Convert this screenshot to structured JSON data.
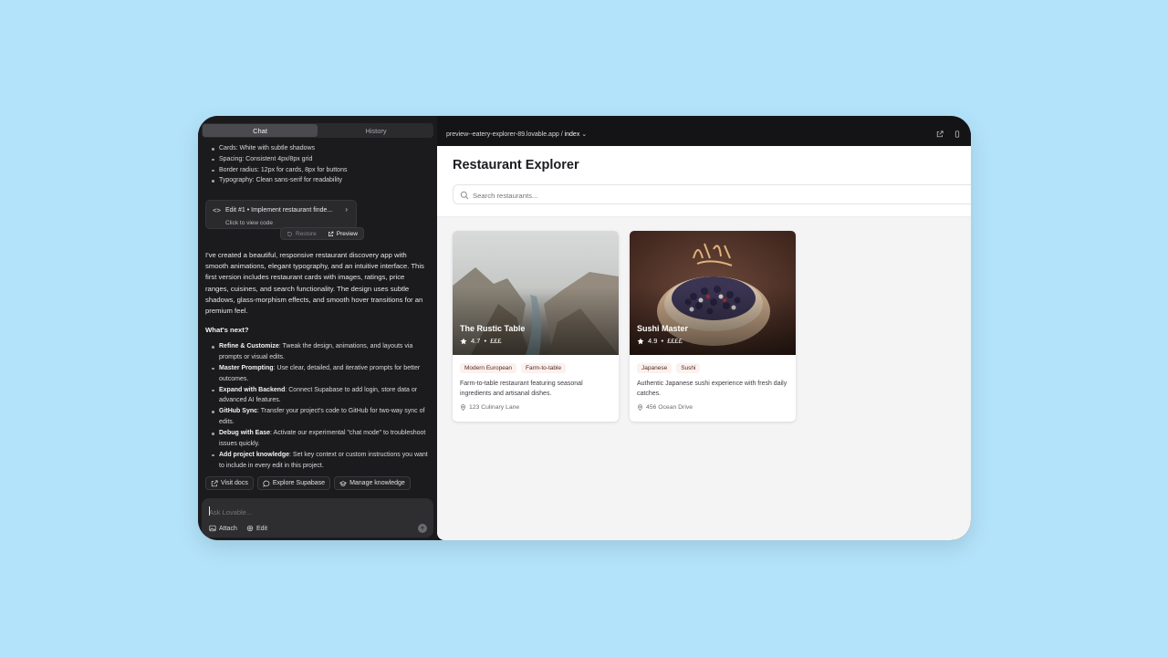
{
  "tabs": [
    "Chat",
    "History"
  ],
  "spec_bullets": [
    "Cards: White with subtle shadows",
    "Spacing: Consistent 4px/8px grid",
    "Border radius: 12px for cards, 8px for buttons",
    "Typography: Clean sans-serif for readability"
  ],
  "edit_card": {
    "title": "Edit #1 • Implement restaurant finde...",
    "subtitle": "Click to view code",
    "restore_label": "Restore",
    "preview_label": "Preview"
  },
  "summary": "I've created a beautiful, responsive restaurant discovery app with smooth animations, elegant typography, and an intuitive interface. This first version includes restaurant cards with images, ratings, price ranges, cuisines, and search functionality. The design uses subtle shadows, glass-morphism effects, and smooth hover transitions for an premium feel.",
  "whats_next": {
    "heading": "What's next?",
    "items": [
      {
        "bold": "Refine & Customize",
        "text": ": Tweak the design, animations, and layouts via prompts or visual edits."
      },
      {
        "bold": "Master Prompting",
        "text": ": Use clear, detailed, and iterative prompts for better outcomes."
      },
      {
        "bold": "Expand with Backend",
        "text": ": Connect Supabase to add login, store data or advanced AI features."
      },
      {
        "bold": "GitHub Sync",
        "text": ": Transfer your project's code to GitHub for two-way sync of edits."
      },
      {
        "bold": "Debug with Ease",
        "text": ": Activate our experimental \"chat mode\" to troubleshoot issues quickly."
      },
      {
        "bold": "Add project knowledge",
        "text": ": Set key context or custom instructions you want to include in every edit in this project."
      }
    ]
  },
  "quick_actions": {
    "visit_docs": "Visit docs",
    "explore_supabase": "Explore Supabase",
    "manage_knowledge": "Manage knowledge"
  },
  "composer": {
    "placeholder": "Ask Lovable...",
    "attach": "Attach",
    "edit": "Edit"
  },
  "preview": {
    "url": "preview--eatery-explorer-89.lovable.app",
    "separator": "/",
    "path": "index"
  },
  "app": {
    "title": "Restaurant Explorer",
    "search_placeholder": "Search restaurants...",
    "restaurants": [
      {
        "name": "The Rustic Table",
        "rating": "4.7",
        "price": "£££",
        "tags": [
          "Modern European",
          "Farm-to-table"
        ],
        "description": "Farm-to-table restaurant featuring seasonal ingredients and artisanal dishes.",
        "address": "123 Culinary Lane"
      },
      {
        "name": "Sushi Master",
        "rating": "4.9",
        "price": "££££",
        "tags": [
          "Japanese",
          "Sushi"
        ],
        "description": "Authentic Japanese sushi experience with fresh daily catches.",
        "address": "456 Ocean Drive"
      }
    ]
  },
  "colors": {
    "page_bg": "#b3e3fa",
    "panel_dark": "#1b1b1d",
    "app_bg": "#f4f4f5",
    "tag_bg": "#fbf1ef"
  }
}
